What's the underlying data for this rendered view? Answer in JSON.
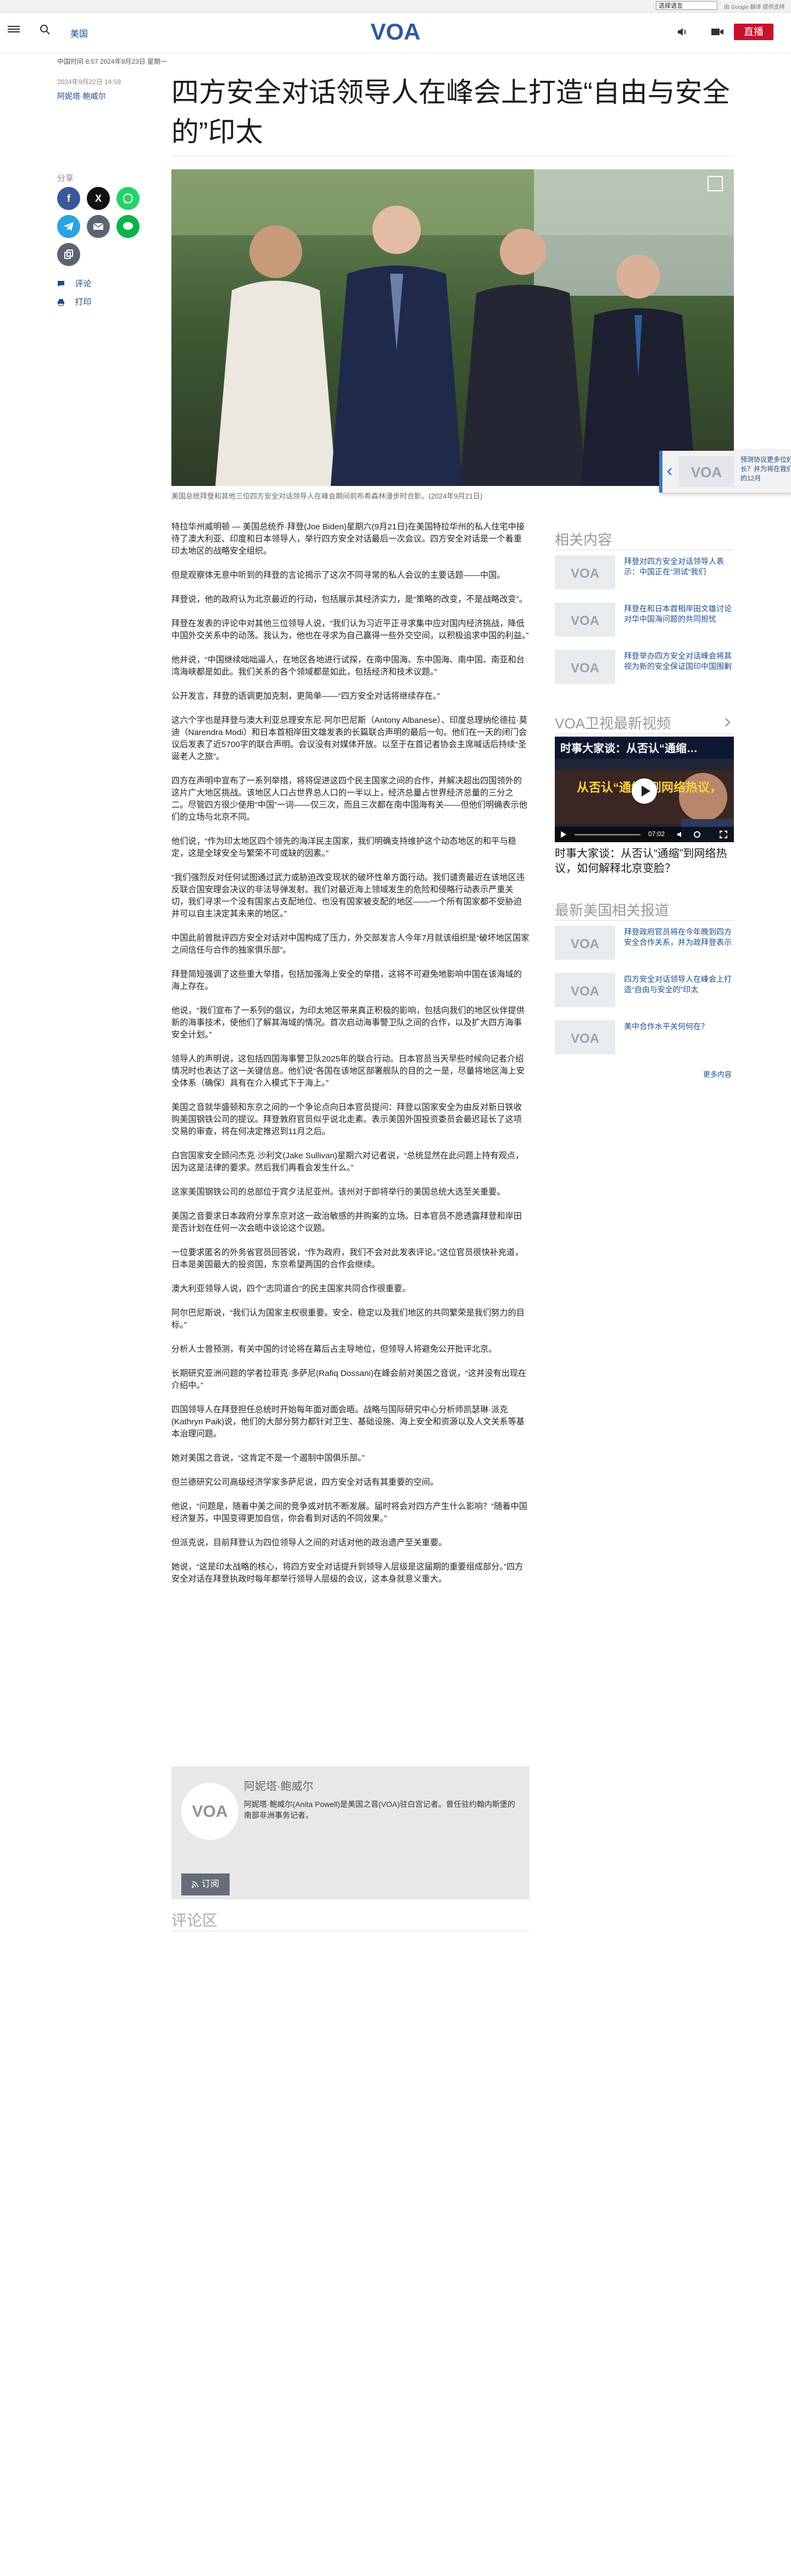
{
  "translate_bar": {
    "select_label": "选择语言",
    "powered_by": "由 Google 翻译 提供支持"
  },
  "header": {
    "nav_label": "美国",
    "logo_text": "VOA",
    "live_label": "直播",
    "live_color": "#c8102e"
  },
  "article": {
    "meta_line": "中国时间 8:57 2024年9月23日 星期一",
    "date": "2024年9月22日 14:59",
    "author": "阿妮塔·鲍威尔",
    "title": "四方安全对话领导人在峰会上打造“自由与安全的”印太",
    "share_label": "分享",
    "comment_link": "评论",
    "print_link": "打印",
    "caption": "美国总统拜登和其他三位四方安全对话领导人在峰会期间前布希森林漫步时合影。(2024年9月21日)",
    "paragraphs": [
      "特拉华州威明顿 — 美国总统乔·拜登(Joe Biden)星期六(9月21日)在美国特拉华州的私人住宅中接待了澳大利亚、印度和日本领导人，举行四方安全对话最后一次会议。四方安全对话是一个着重印太地区的战略安全组织。",
      "但是观察体无意中听到的拜登的言论揭示了这次不同寻常的私人会议的主要话题——中国。",
      "拜登说，他的政府认为北京最近的行动，包括展示其经济实力，是“策略的改变，不是战略改变”。",
      "拜登在发表的评论中对其他三位领导人说，“我们认为习近平正寻求集中应对国内经济挑战，降低中国外交关系中的动荡。我认为，他也在寻求为自己赢得一些外交空间，以积极追求中国的利益。”",
      "他并说，“中国继续咄咄逼人，在地区各地进行试探，在南中国海、东中国海、南中国、南亚和台湾海峡都是如此。我们关系的各个领域都是如此，包括经济和技术议题。”",
      "公开发言，拜登的语调更加克制，更简单——“四方安全对话将继续存在。”",
      "这六个字也是拜登与澳大利亚总理安东尼·阿尔巴尼斯（Antony Albanese）、印度总理纳伦德拉·莫迪（Narendra Modi）和日本首相岸田文雄发表的长篇联合声明的最后一句。他们在一天的闭门会议后发表了近5700字的联合声明。会议没有对媒体开放。以至于在首记者协会主席喊话后持续“圣诞老人之旅”。",
      "四方在声明中宣布了一系列举措，将将促进这四个民主国家之间的合作，并解决超出四国领外的这片广大地区挑战。该地区人口占世界总人口的一半以上，经济总量占世界经济总量的三分之二。尽管四方很少使用“中国”一词——仅三次，而且三次都在南中国海有关——但他们明确表示他们的立场与北京不同。",
      "他们说，“作为印太地区四个领先的海洋民主国家，我们明确支持维护这个动态地区的和平与稳定，这是全球安全与繁荣不可或缺的因素。”",
      "“我们强烈反对任何试图通过武力或胁迫改变现状的破坏性单方面行动。我们谴责最近在该地区违反联合国安理会决议的非法导弹发射。我们对最近海上领域发生的危险和侵略行动表示严重关切，我们寻求一个没有国家占支配地位、也没有国家被支配的地区——一个所有国家都不受胁迫并可以自主决定其未来的地区。”",
      "中国此前曾批评四方安全对话对中国构成了压力，外交部发言人今年7月就该组织是“破坏地区国家之间信任与合作的独家俱乐部”。",
      "拜登简短强调了这些重大举措，包括加强海上安全的举措，这将不可避免地影响中国在该海域的海上存在。",
      "他说，“我们宣布了一系列的倡议，为印太地区带来真正积极的影响，包括向我们的地区伙伴提供新的海事技术，使他们了解其海域的情况。首次启动海事警卫队之间的合作，以及扩大四方海事安全计划。”",
      "领导人的声明说，这包括四国海事警卫队2025年的联合行动。日本官员当天早些时候向记者介绍情况时也表达了这一关键信息。他们说“各国在该地区部署舰队的目的之一是，尽量将地区海上安全体系（确保）具有在介入模式下于海上。”",
      "美国之音就华盛顿和东京之间的一个争论点向日本官员提问：拜登以国家安全为由反对新日铁收购美国钢铁公司的提议。拜登敦府官员似乎说北走素。表示美国外国投资委员会最迟延长了这项交易的审查，将在何决定推迟到11月之后。",
      "白宫国家安全顾问杰克·沙利文(Jake Sullivan)星期六对记者说，“总统显然在此问题上持有观点，因为这是法律的要求。然后我们再看会发生什么。”",
      "这家美国钢铁公司的总部位于宾夕法尼亚州。该州对于即将举行的美国总统大选至关重要。",
      "美国之音要求日本政府分享东京对这一政治敏感的并购案的立场。日本官员不愿透露拜登和岸田是否计划在任何一次会晤中谈论这个议题。",
      "一位要求匿名的外务省官员回答说，“作为政府，我们不会对此发表评论。”这位官员很快补充道，日本是美国最大的投资国，东京希望两国的合作会继续。",
      "澳大利亚领导人说，四个“志同道合”的民主国家共同合作很重要。",
      "阿尔巴尼斯说，“我们认为国家主权很重要。安全、稳定以及我们地区的共同繁荣是我们努力的目标。”",
      "分析人士曾预测，有关中国的讨论将在幕后占主导地位，但领导人将避免公开批评北京。",
      "长期研究亚洲问题的学者拉菲克·多萨尼(Rafiq Dossani)在峰会前对美国之音说，“这并没有出现在介绍中。”",
      "四国领导人在拜登担任总统时开始每年面对面会晤。战略与国际研究中心分析师凯瑟琳·派克(Kathryn Paik)说，他们的大部分努力都针对卫生、基础设施、海上安全和资源以及人文关系等基本治理问题。",
      "她对美国之音说，“这肯定不是一个遏制中国俱乐部。”",
      "但兰德研究公司高级经济学家多萨尼说，四方安全对话有其重要的空间。",
      "他说，“问题是，随着中美之间的竞争或对抗不断发展。届时将会对四方产生什么影响？“随着中国经济复苏，中国变得更加自信，你会看到对话的不同效果。”",
      "但派克说，目前拜登认为四位领导人之间的对话对他的政治遗产至关重要。",
      "她说，“这是印太战略的核心，将四方安全对话提升到领导人层级是这届期的重要组成部分。”四方安全对话在拜登执政时每年都举行领导人层级的会议，这本身就意义重大。"
    ],
    "author_box": {
      "name": "阿妮塔·鲍威尔",
      "description": "阿妮塔·鲍威尔(Anita Powell)是美国之音(VOA)驻白宫记者。曾任驻约翰内斯堡的南部非洲事务记者。",
      "subscribe_label": "订阅"
    },
    "comments_label": "评论区"
  },
  "sidebar": {
    "related_title": "相关内容",
    "related": [
      {
        "title": "拜登对四方安全对话领导人表示：中国正在“测试”我们"
      },
      {
        "title": "拜登在和日本首相岸田文雄讨论对华中国海问题的共同担忧"
      },
      {
        "title": "拜登举办四方安全对话峰会将其视为新的安全保证国印中国围剿"
      }
    ],
    "video_section_title": "VOA卫视最新视频",
    "video": {
      "banner_text": "时事大家谈：从否认“通缩…",
      "overlay_text": "从否认“通缩”到网络热议，",
      "time": "07:02",
      "caption": "时事大家谈：从否认“通缩”到网络热议，如何解释北京变脸？"
    },
    "latest_title": "最新美国相关报道",
    "latest": [
      {
        "title": "拜登政府官员将在今年晚到四方安全合作关系，并为政拜登表示"
      },
      {
        "title": "四方安全对话领导人在峰会上打造“自由与安全的”印太"
      },
      {
        "title": "美中合作水平关何何在？"
      }
    ],
    "more_label": "更多内容",
    "floating": {
      "text": "预测协议更多位好长？并为将在我们的12月"
    }
  },
  "colors": {
    "link_blue": "#1a4d8c",
    "facebook": "#3b5998",
    "x": "#111111",
    "whatsapp": "#25d366",
    "telegram": "#2aa3e0",
    "email": "#5a6573",
    "line": "#0ab34a",
    "copy": "#5a6573"
  }
}
